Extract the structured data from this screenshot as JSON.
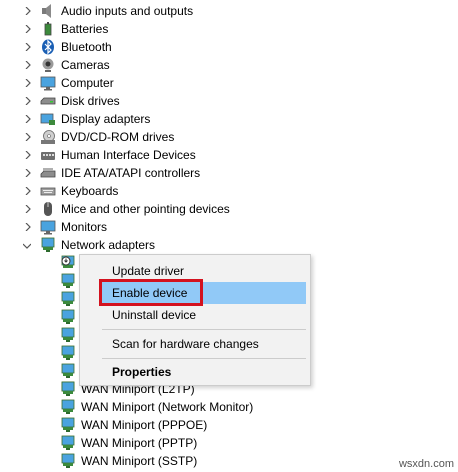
{
  "tree": {
    "items": [
      {
        "label": "Audio inputs and outputs",
        "icon": "speaker-icon"
      },
      {
        "label": "Batteries",
        "icon": "battery-icon"
      },
      {
        "label": "Bluetooth",
        "icon": "bluetooth-icon"
      },
      {
        "label": "Cameras",
        "icon": "camera-icon"
      },
      {
        "label": "Computer",
        "icon": "monitor-icon"
      },
      {
        "label": "Disk drives",
        "icon": "disk-drive-icon"
      },
      {
        "label": "Display adapters",
        "icon": "display-adapter-icon"
      },
      {
        "label": "DVD/CD-ROM drives",
        "icon": "dvd-icon"
      },
      {
        "label": "Human Interface Devices",
        "icon": "hid-icon"
      },
      {
        "label": "IDE ATA/ATAPI controllers",
        "icon": "ide-icon"
      },
      {
        "label": "Keyboards",
        "icon": "keyboard-icon"
      },
      {
        "label": "Mice and other pointing devices",
        "icon": "mouse-icon"
      },
      {
        "label": "Monitors",
        "icon": "monitor-icon"
      },
      {
        "label": "Network adapters",
        "icon": "network-adapter-icon",
        "expanded": true
      }
    ],
    "children": [
      {
        "label": ""
      },
      {
        "label": ""
      },
      {
        "label": ""
      },
      {
        "label": ""
      },
      {
        "label": ""
      },
      {
        "label": ""
      },
      {
        "label": ""
      },
      {
        "label": ""
      },
      {
        "label": "WAN Miniport (L2TP)"
      },
      {
        "label": "WAN Miniport (Network Monitor)"
      },
      {
        "label": "WAN Miniport (PPPOE)"
      },
      {
        "label": "WAN Miniport (PPTP)"
      },
      {
        "label": "WAN Miniport (SSTP)"
      }
    ]
  },
  "context_menu": {
    "update_driver": "Update driver",
    "enable_device": "Enable device",
    "uninstall_device": "Uninstall device",
    "scan_hardware": "Scan for hardware changes",
    "properties": "Properties"
  },
  "watermark": "wsxdn.com",
  "colors": {
    "highlight": "#91c9f7",
    "callout_border": "#d3121f",
    "menu_bg": "#f2f2f2"
  }
}
